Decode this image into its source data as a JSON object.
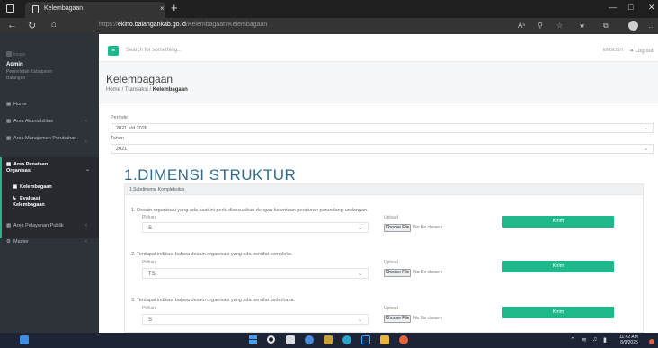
{
  "browser": {
    "tab_title": "Kelembagaan",
    "tab_close": "×",
    "new_tab": "+",
    "url_prefix": "https://",
    "url_host": "ekino.balangankab.go.id",
    "url_path": "/Kelembagaan/Kelembagaan"
  },
  "sidebar": {
    "logo_alt": "image",
    "user_name": "Admin",
    "user_org": "Pemerintah Kabupaten Balangan",
    "items": [
      {
        "label": "Home",
        "icon": "grid-icon"
      },
      {
        "label": "Area Akuntabilitas",
        "icon": "chart-icon"
      },
      {
        "label": "Area Manajemen Perubahan",
        "icon": "chart-icon"
      },
      {
        "label": "Area Penataan Organisasi",
        "icon": "chart-icon"
      },
      {
        "label": "Kelembagaan",
        "icon": "building-icon"
      },
      {
        "label": "Evaluasi Kelembagaan",
        "icon": "list-icon"
      },
      {
        "label": "Area Pelayanan Publik",
        "icon": "chart-icon"
      },
      {
        "label": "Master",
        "icon": "gear-icon"
      }
    ]
  },
  "topbar": {
    "search_placeholder": "Search for something...",
    "language": "ENGLISH",
    "logout": "Log out"
  },
  "page": {
    "title": "Kelembagaan",
    "breadcrumb": [
      "Home",
      "Transaksi",
      "Kelembagaan"
    ]
  },
  "filters": {
    "periode_label": "Periode",
    "periode_value": "2021 s/d 2026",
    "tahun_label": "Tahun",
    "tahun_value": "2021"
  },
  "section": {
    "title": "1.DIMENSI STRUKTUR",
    "subdimension": "1.Subdimensi Kompleksitas",
    "pilihan_label": "Pilihan",
    "upload_label": "Upload",
    "choose_file": "Choose File",
    "no_file": "No file chosen",
    "submit_label": "Kirim",
    "questions": [
      {
        "text": "1. Desain organisasi yang ada saat ini perlu disesuaikan dengan ketentuan peraturan perundang-undangan.",
        "choice": "S"
      },
      {
        "text": "2. Terdapat indikasi bahwa desain organisasi yang ada bersifat kompleks.",
        "choice": "TS"
      },
      {
        "text": "3. Terdapat indikasi bahwa desain organisasi yang ada bersifat sederhana.",
        "choice": "S"
      }
    ]
  },
  "taskbar": {
    "time": "11:42 AM",
    "date": "8/9/2025"
  }
}
